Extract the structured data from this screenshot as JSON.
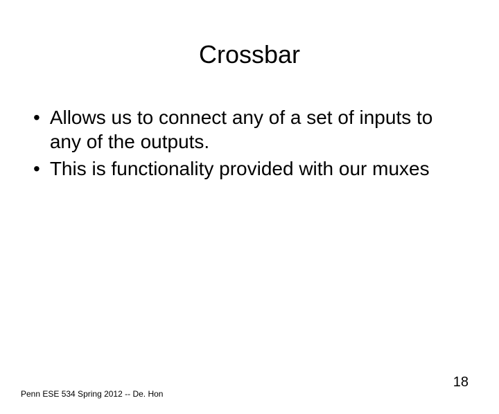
{
  "title": "Crossbar",
  "bullets": [
    "Allows us to connect any of a set of inputs to any of the outputs.",
    "This is functionality provided with our muxes"
  ],
  "footer": {
    "left": "Penn ESE 534 Spring 2012 -- De. Hon",
    "right": "18"
  }
}
